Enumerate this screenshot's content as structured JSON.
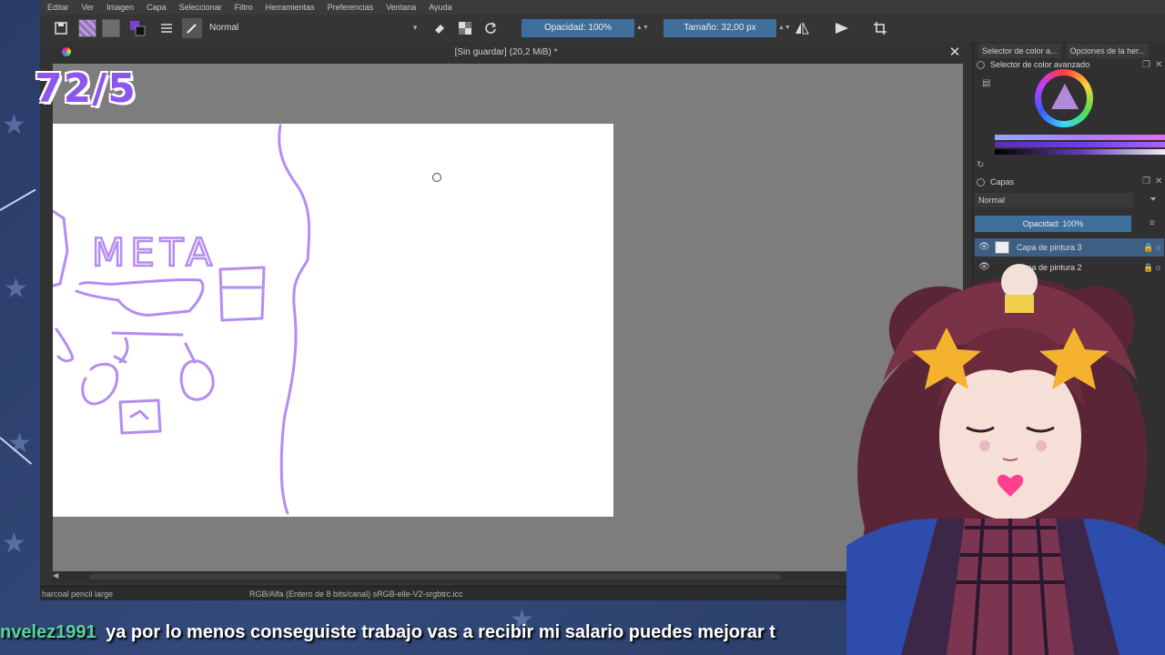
{
  "counter": "72/5",
  "menu": [
    "Editar",
    "Ver",
    "Imagen",
    "Capa",
    "Seleccionar",
    "Filtro",
    "Herramientas",
    "Preferencias",
    "Ventana",
    "Ayuda"
  ],
  "toolbar": {
    "blend_mode": "Normal",
    "opacity_label": "Opacidad: 100%",
    "size_label": "Tamaño: 32,00 px"
  },
  "document": {
    "title": "[Sin guardar]  (20,2 MiB) *",
    "drawing_text": "META"
  },
  "dockers": {
    "tabs": [
      "Selector de color a...",
      "Opciones de la her..."
    ],
    "color_panel_title": "Selector de color avanzado",
    "layers_panel_title": "Capas",
    "layers_blend": "Normal",
    "layers_opacity": "Opacidad:  100%",
    "layers": [
      {
        "name": "Capa de pintura 3",
        "active": true
      },
      {
        "name": "Capa de pintura 2",
        "active": false
      }
    ]
  },
  "statusbar": {
    "brush": "harcoal pencil large",
    "color_info": "RGB/Alfa (Entero de 8 bits/canal)  sRGB-elle-V2-srgbtrc.icc"
  },
  "chat": {
    "user": "nvelez1991",
    "message": "ya por lo menos conseguiste trabajo vas a recibir mi salario puedes mejorar t"
  },
  "colors": {
    "accent_slider": "#3d6e9c",
    "counter": "#8d57ef",
    "chat_user": "#58d39a",
    "sketch_stroke": "#b58cf2"
  }
}
